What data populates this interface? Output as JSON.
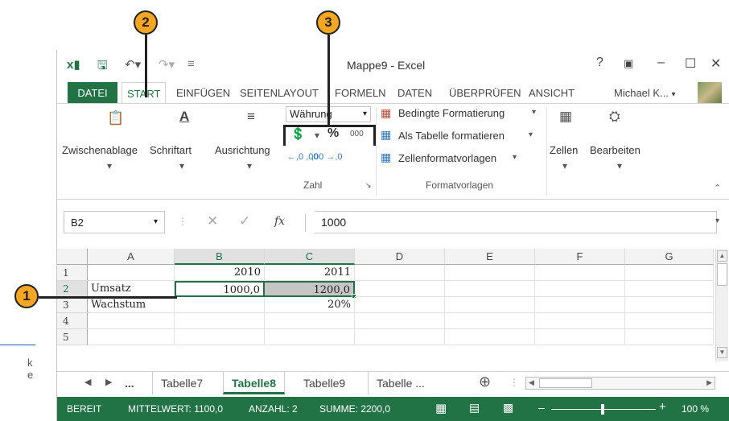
{
  "callouts": [
    "1",
    "2",
    "3"
  ],
  "app": {
    "title": "Mappe9 - Excel",
    "help": "?",
    "user": "Michael K... "
  },
  "tabs": [
    {
      "label": "DATEI"
    },
    {
      "label": "START"
    },
    {
      "label": "EINFÜGEN"
    },
    {
      "label": "SEITENLAYOUT"
    },
    {
      "label": "FORMELN"
    },
    {
      "label": "DATEN"
    },
    {
      "label": "ÜBERPRÜFEN"
    },
    {
      "label": "ANSICHT"
    }
  ],
  "ribbon": {
    "zwischenablage": "Zwischenablage",
    "schriftart": "Schriftart",
    "ausrichtung": "Ausrichtung",
    "number_format": "Währung",
    "percent": "%",
    "thousands": "000",
    "dec_inc": "←,0 ,00",
    "dec_dec": ",00 →,0",
    "zahl": "Zahl",
    "bedingte": "Bedingte Formatierung",
    "als_tabelle": "Als Tabelle formatieren",
    "zellformat": "Zellenformatvorlagen",
    "formatvorlagen": "Formatvorlagen",
    "zellen": "Zellen",
    "bearbeiten": "Bearbeiten"
  },
  "formula_bar": {
    "name_box": "B2",
    "fx": "fx",
    "value": "1000"
  },
  "grid": {
    "columns": [
      "A",
      "B",
      "C",
      "D",
      "E",
      "F",
      "G"
    ],
    "rows": [
      {
        "num": "1",
        "cells": [
          "",
          "2010",
          "2011",
          "",
          "",
          "",
          ""
        ]
      },
      {
        "num": "2",
        "cells": [
          "Umsatz",
          "1000,0",
          "1200,0",
          "",
          "",
          "",
          ""
        ]
      },
      {
        "num": "3",
        "cells": [
          "Wachstum",
          "",
          "20%",
          "",
          "",
          "",
          ""
        ]
      },
      {
        "num": "4",
        "cells": [
          "",
          "",
          "",
          "",
          "",
          "",
          ""
        ]
      },
      {
        "num": "5",
        "cells": [
          "",
          "",
          "",
          "",
          "",
          "",
          ""
        ]
      }
    ]
  },
  "sheets": {
    "more": "...",
    "tabs": [
      "Tabelle7",
      "Tabelle8",
      "Tabelle9",
      "Tabelle ..."
    ],
    "active": "Tabelle8"
  },
  "status": {
    "ready": "BEREIT",
    "avg": "MITTELWERT: 1100,0",
    "count": "ANZAHL: 2",
    "sum": "SUMME: 2200,0",
    "zoom": "100 %"
  },
  "margin_text": [
    "k",
    "e"
  ],
  "colors": {
    "accent": "#217346",
    "callout": "#f5a623"
  }
}
